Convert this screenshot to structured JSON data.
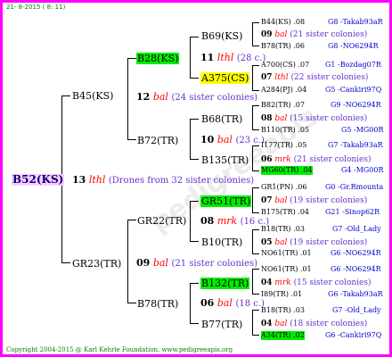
{
  "header": {
    "date": "21- 8-2015 ( 8: 11)"
  },
  "footer": {
    "copyright": "Copyright 2004-2015 @ Karl Kehrle Foundation.   www.pedigreeapis.org"
  },
  "root": {
    "queen": "B52(KS)",
    "year": "13",
    "race": "lthl",
    "note": "(Drones from 32 sister colonies)"
  },
  "gen1": {
    "top": {
      "queen": "B45(KS)",
      "year": "12",
      "race": "bal",
      "note": "(24 sister colonies)"
    },
    "bottom": {
      "queen": "GR23(TR)",
      "year": "09",
      "race": "bal",
      "note": "(21 sister colonies)"
    }
  },
  "gen2": {
    "a": {
      "queen": "B28(KS)",
      "year": "11",
      "race": "lthl",
      "note": "(28 c.)"
    },
    "b": {
      "queen": "B72(TR)",
      "year": "10",
      "race": "bal",
      "note": "(23 c.)"
    },
    "c": {
      "queen": "GR22(TR)",
      "year": "08",
      "race": "mrk",
      "note": "(16 c.)"
    },
    "d": {
      "queen": "B78(TR)",
      "year": "06",
      "race": "bal",
      "note": "(18 c.)"
    }
  },
  "gen3": {
    "a1": {
      "queen": "B69(KS)",
      "year": "09",
      "race": "bal",
      "note": "(21 sister colonies)"
    },
    "a2": {
      "queen": "A375(CS)",
      "year": "07",
      "race": "lthl",
      "note": "(22 sister colonies)"
    },
    "b1": {
      "queen": "B68(TR)",
      "year": "08",
      "race": "bal",
      "note": "(15 sister colonies)"
    },
    "b2": {
      "queen": "B135(TR)",
      "year": "06",
      "race": "mrk",
      "note": "(21 sister colonies)"
    },
    "c1": {
      "queen": "GR51(TR)",
      "year": "07",
      "race": "bal",
      "note": "(19 sister colonies)"
    },
    "c2": {
      "queen": "B10(TR)",
      "year": "05",
      "race": "bal",
      "note": "(19 sister colonies)"
    },
    "d1": {
      "queen": "B132(TR)",
      "year": "04",
      "race": "mrk",
      "note": "(15 sister colonies)"
    },
    "d2": {
      "queen": "B77(TR)",
      "year": "04",
      "race": "bal",
      "note": "(18 sister colonies)"
    }
  },
  "gen4": [
    {
      "queen": "B44(KS)",
      "yr": ".08",
      "breeder": "G8 -Takab93aR"
    },
    {
      "queen": "B78(TR)",
      "yr": ".06",
      "breeder": "G8 -NO6294R"
    },
    {
      "queen": "A700(CS)",
      "yr": ".07",
      "breeder": "G1 -Bozdag07R"
    },
    {
      "queen": "A284(PJ)",
      "yr": ".04",
      "breeder": "G5 -Cankiri97Q"
    },
    {
      "queen": "B82(TR)",
      "yr": ".07",
      "breeder": "G9 -NO6294R"
    },
    {
      "queen": "B110(TR)",
      "yr": ".05",
      "breeder": "G5 -MG00R"
    },
    {
      "queen": "I177(TR)",
      "yr": ".05",
      "breeder": "G7 -Takab93aR"
    },
    {
      "queen": "MG60(TR)",
      "yr": ".04",
      "breeder": "G4 -MG00R"
    },
    {
      "queen": "GR1(PN)",
      "yr": ".06",
      "breeder": "G0 -Gr.Rmounta"
    },
    {
      "queen": "B175(TR)",
      "yr": ".04",
      "breeder": "G21 -Sinop62R"
    },
    {
      "queen": "B18(TR)",
      "yr": ".03",
      "breeder": "G7 -Old_Lady"
    },
    {
      "queen": "NO61(TR)",
      "yr": ".01",
      "breeder": "G6 -NO6294R"
    },
    {
      "queen": "NO61(TR)",
      "yr": ".01",
      "breeder": "G6 -NO6294R"
    },
    {
      "queen": "I89(TR)",
      "yr": ".01",
      "breeder": "G6 -Takab93aR"
    },
    {
      "queen": "B18(TR)",
      "yr": ".03",
      "breeder": "G7 -Old_Lady"
    },
    {
      "queen": "A34(TR)",
      "yr": ".02",
      "breeder": "G6 -Cankiri97Q"
    }
  ]
}
